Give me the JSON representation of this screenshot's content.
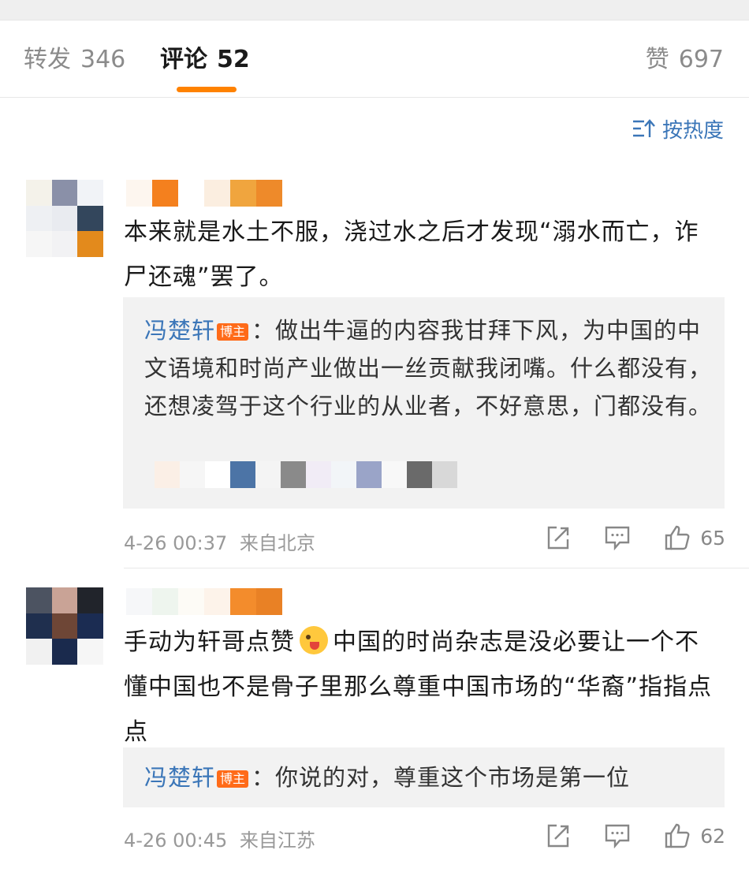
{
  "tabs": {
    "repost": {
      "label": "转发",
      "count": "346"
    },
    "comment": {
      "label": "评论",
      "count": "52"
    },
    "like": {
      "label": "赞",
      "count": "697"
    }
  },
  "sort": {
    "label": "按热度",
    "icon": "sort-icon"
  },
  "comments": [
    {
      "text": "本来就是水土不服，浇过水之后才发现“溺水而亡，诈尸还魂”罢了。",
      "reply": {
        "name": "冯楚轩",
        "badge": "博主",
        "colon": "：",
        "text": "做出牛逼的内容我甘拜下风，为中国的中文语境和时尚产业做出一丝贡献我闭嘴。什么都没有，还想凌驾于这个行业的从业者，不好意思，门都没有。"
      },
      "time": "4-26 00:37",
      "source": "来自北京",
      "likes": "65"
    },
    {
      "text_before": "手动为轩哥点赞",
      "emoji": "grin-emoji",
      "text_after": "中国的时尚杂志是没必要让一个不懂中国也不是骨子里那么尊重中国市场的“华裔”指指点点",
      "reply": {
        "name": "冯楚轩",
        "badge": "博主",
        "colon": "：",
        "text": "你说的对，尊重这个市场是第一位"
      },
      "time": "4-26 00:45",
      "source": "来自江苏",
      "likes": "62"
    }
  ],
  "colors": {
    "accent": "#ff8200",
    "link": "#3b76b8",
    "badge": "#ff6b19"
  }
}
